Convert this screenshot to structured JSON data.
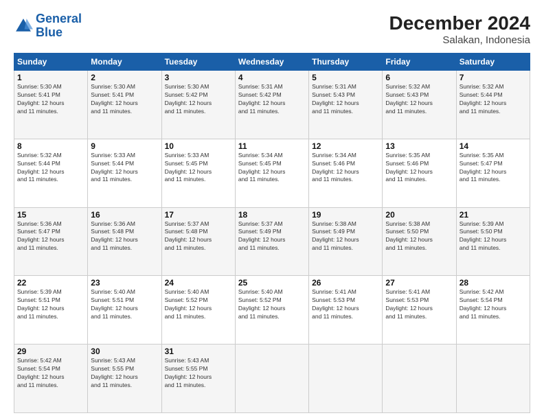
{
  "logo": {
    "line1": "General",
    "line2": "Blue"
  },
  "title": "December 2024",
  "subtitle": "Salakan, Indonesia",
  "days_of_week": [
    "Sunday",
    "Monday",
    "Tuesday",
    "Wednesday",
    "Thursday",
    "Friday",
    "Saturday"
  ],
  "weeks": [
    [
      {
        "day": 1,
        "info": "Sunrise: 5:30 AM\nSunset: 5:41 PM\nDaylight: 12 hours\nand 11 minutes."
      },
      {
        "day": 2,
        "info": "Sunrise: 5:30 AM\nSunset: 5:41 PM\nDaylight: 12 hours\nand 11 minutes."
      },
      {
        "day": 3,
        "info": "Sunrise: 5:30 AM\nSunset: 5:42 PM\nDaylight: 12 hours\nand 11 minutes."
      },
      {
        "day": 4,
        "info": "Sunrise: 5:31 AM\nSunset: 5:42 PM\nDaylight: 12 hours\nand 11 minutes."
      },
      {
        "day": 5,
        "info": "Sunrise: 5:31 AM\nSunset: 5:43 PM\nDaylight: 12 hours\nand 11 minutes."
      },
      {
        "day": 6,
        "info": "Sunrise: 5:32 AM\nSunset: 5:43 PM\nDaylight: 12 hours\nand 11 minutes."
      },
      {
        "day": 7,
        "info": "Sunrise: 5:32 AM\nSunset: 5:44 PM\nDaylight: 12 hours\nand 11 minutes."
      }
    ],
    [
      {
        "day": 8,
        "info": "Sunrise: 5:32 AM\nSunset: 5:44 PM\nDaylight: 12 hours\nand 11 minutes."
      },
      {
        "day": 9,
        "info": "Sunrise: 5:33 AM\nSunset: 5:44 PM\nDaylight: 12 hours\nand 11 minutes."
      },
      {
        "day": 10,
        "info": "Sunrise: 5:33 AM\nSunset: 5:45 PM\nDaylight: 12 hours\nand 11 minutes."
      },
      {
        "day": 11,
        "info": "Sunrise: 5:34 AM\nSunset: 5:45 PM\nDaylight: 12 hours\nand 11 minutes."
      },
      {
        "day": 12,
        "info": "Sunrise: 5:34 AM\nSunset: 5:46 PM\nDaylight: 12 hours\nand 11 minutes."
      },
      {
        "day": 13,
        "info": "Sunrise: 5:35 AM\nSunset: 5:46 PM\nDaylight: 12 hours\nand 11 minutes."
      },
      {
        "day": 14,
        "info": "Sunrise: 5:35 AM\nSunset: 5:47 PM\nDaylight: 12 hours\nand 11 minutes."
      }
    ],
    [
      {
        "day": 15,
        "info": "Sunrise: 5:36 AM\nSunset: 5:47 PM\nDaylight: 12 hours\nand 11 minutes."
      },
      {
        "day": 16,
        "info": "Sunrise: 5:36 AM\nSunset: 5:48 PM\nDaylight: 12 hours\nand 11 minutes."
      },
      {
        "day": 17,
        "info": "Sunrise: 5:37 AM\nSunset: 5:48 PM\nDaylight: 12 hours\nand 11 minutes."
      },
      {
        "day": 18,
        "info": "Sunrise: 5:37 AM\nSunset: 5:49 PM\nDaylight: 12 hours\nand 11 minutes."
      },
      {
        "day": 19,
        "info": "Sunrise: 5:38 AM\nSunset: 5:49 PM\nDaylight: 12 hours\nand 11 minutes."
      },
      {
        "day": 20,
        "info": "Sunrise: 5:38 AM\nSunset: 5:50 PM\nDaylight: 12 hours\nand 11 minutes."
      },
      {
        "day": 21,
        "info": "Sunrise: 5:39 AM\nSunset: 5:50 PM\nDaylight: 12 hours\nand 11 minutes."
      }
    ],
    [
      {
        "day": 22,
        "info": "Sunrise: 5:39 AM\nSunset: 5:51 PM\nDaylight: 12 hours\nand 11 minutes."
      },
      {
        "day": 23,
        "info": "Sunrise: 5:40 AM\nSunset: 5:51 PM\nDaylight: 12 hours\nand 11 minutes."
      },
      {
        "day": 24,
        "info": "Sunrise: 5:40 AM\nSunset: 5:52 PM\nDaylight: 12 hours\nand 11 minutes."
      },
      {
        "day": 25,
        "info": "Sunrise: 5:40 AM\nSunset: 5:52 PM\nDaylight: 12 hours\nand 11 minutes."
      },
      {
        "day": 26,
        "info": "Sunrise: 5:41 AM\nSunset: 5:53 PM\nDaylight: 12 hours\nand 11 minutes."
      },
      {
        "day": 27,
        "info": "Sunrise: 5:41 AM\nSunset: 5:53 PM\nDaylight: 12 hours\nand 11 minutes."
      },
      {
        "day": 28,
        "info": "Sunrise: 5:42 AM\nSunset: 5:54 PM\nDaylight: 12 hours\nand 11 minutes."
      }
    ],
    [
      {
        "day": 29,
        "info": "Sunrise: 5:42 AM\nSunset: 5:54 PM\nDaylight: 12 hours\nand 11 minutes."
      },
      {
        "day": 30,
        "info": "Sunrise: 5:43 AM\nSunset: 5:55 PM\nDaylight: 12 hours\nand 11 minutes."
      },
      {
        "day": 31,
        "info": "Sunrise: 5:43 AM\nSunset: 5:55 PM\nDaylight: 12 hours\nand 11 minutes."
      },
      null,
      null,
      null,
      null
    ]
  ]
}
